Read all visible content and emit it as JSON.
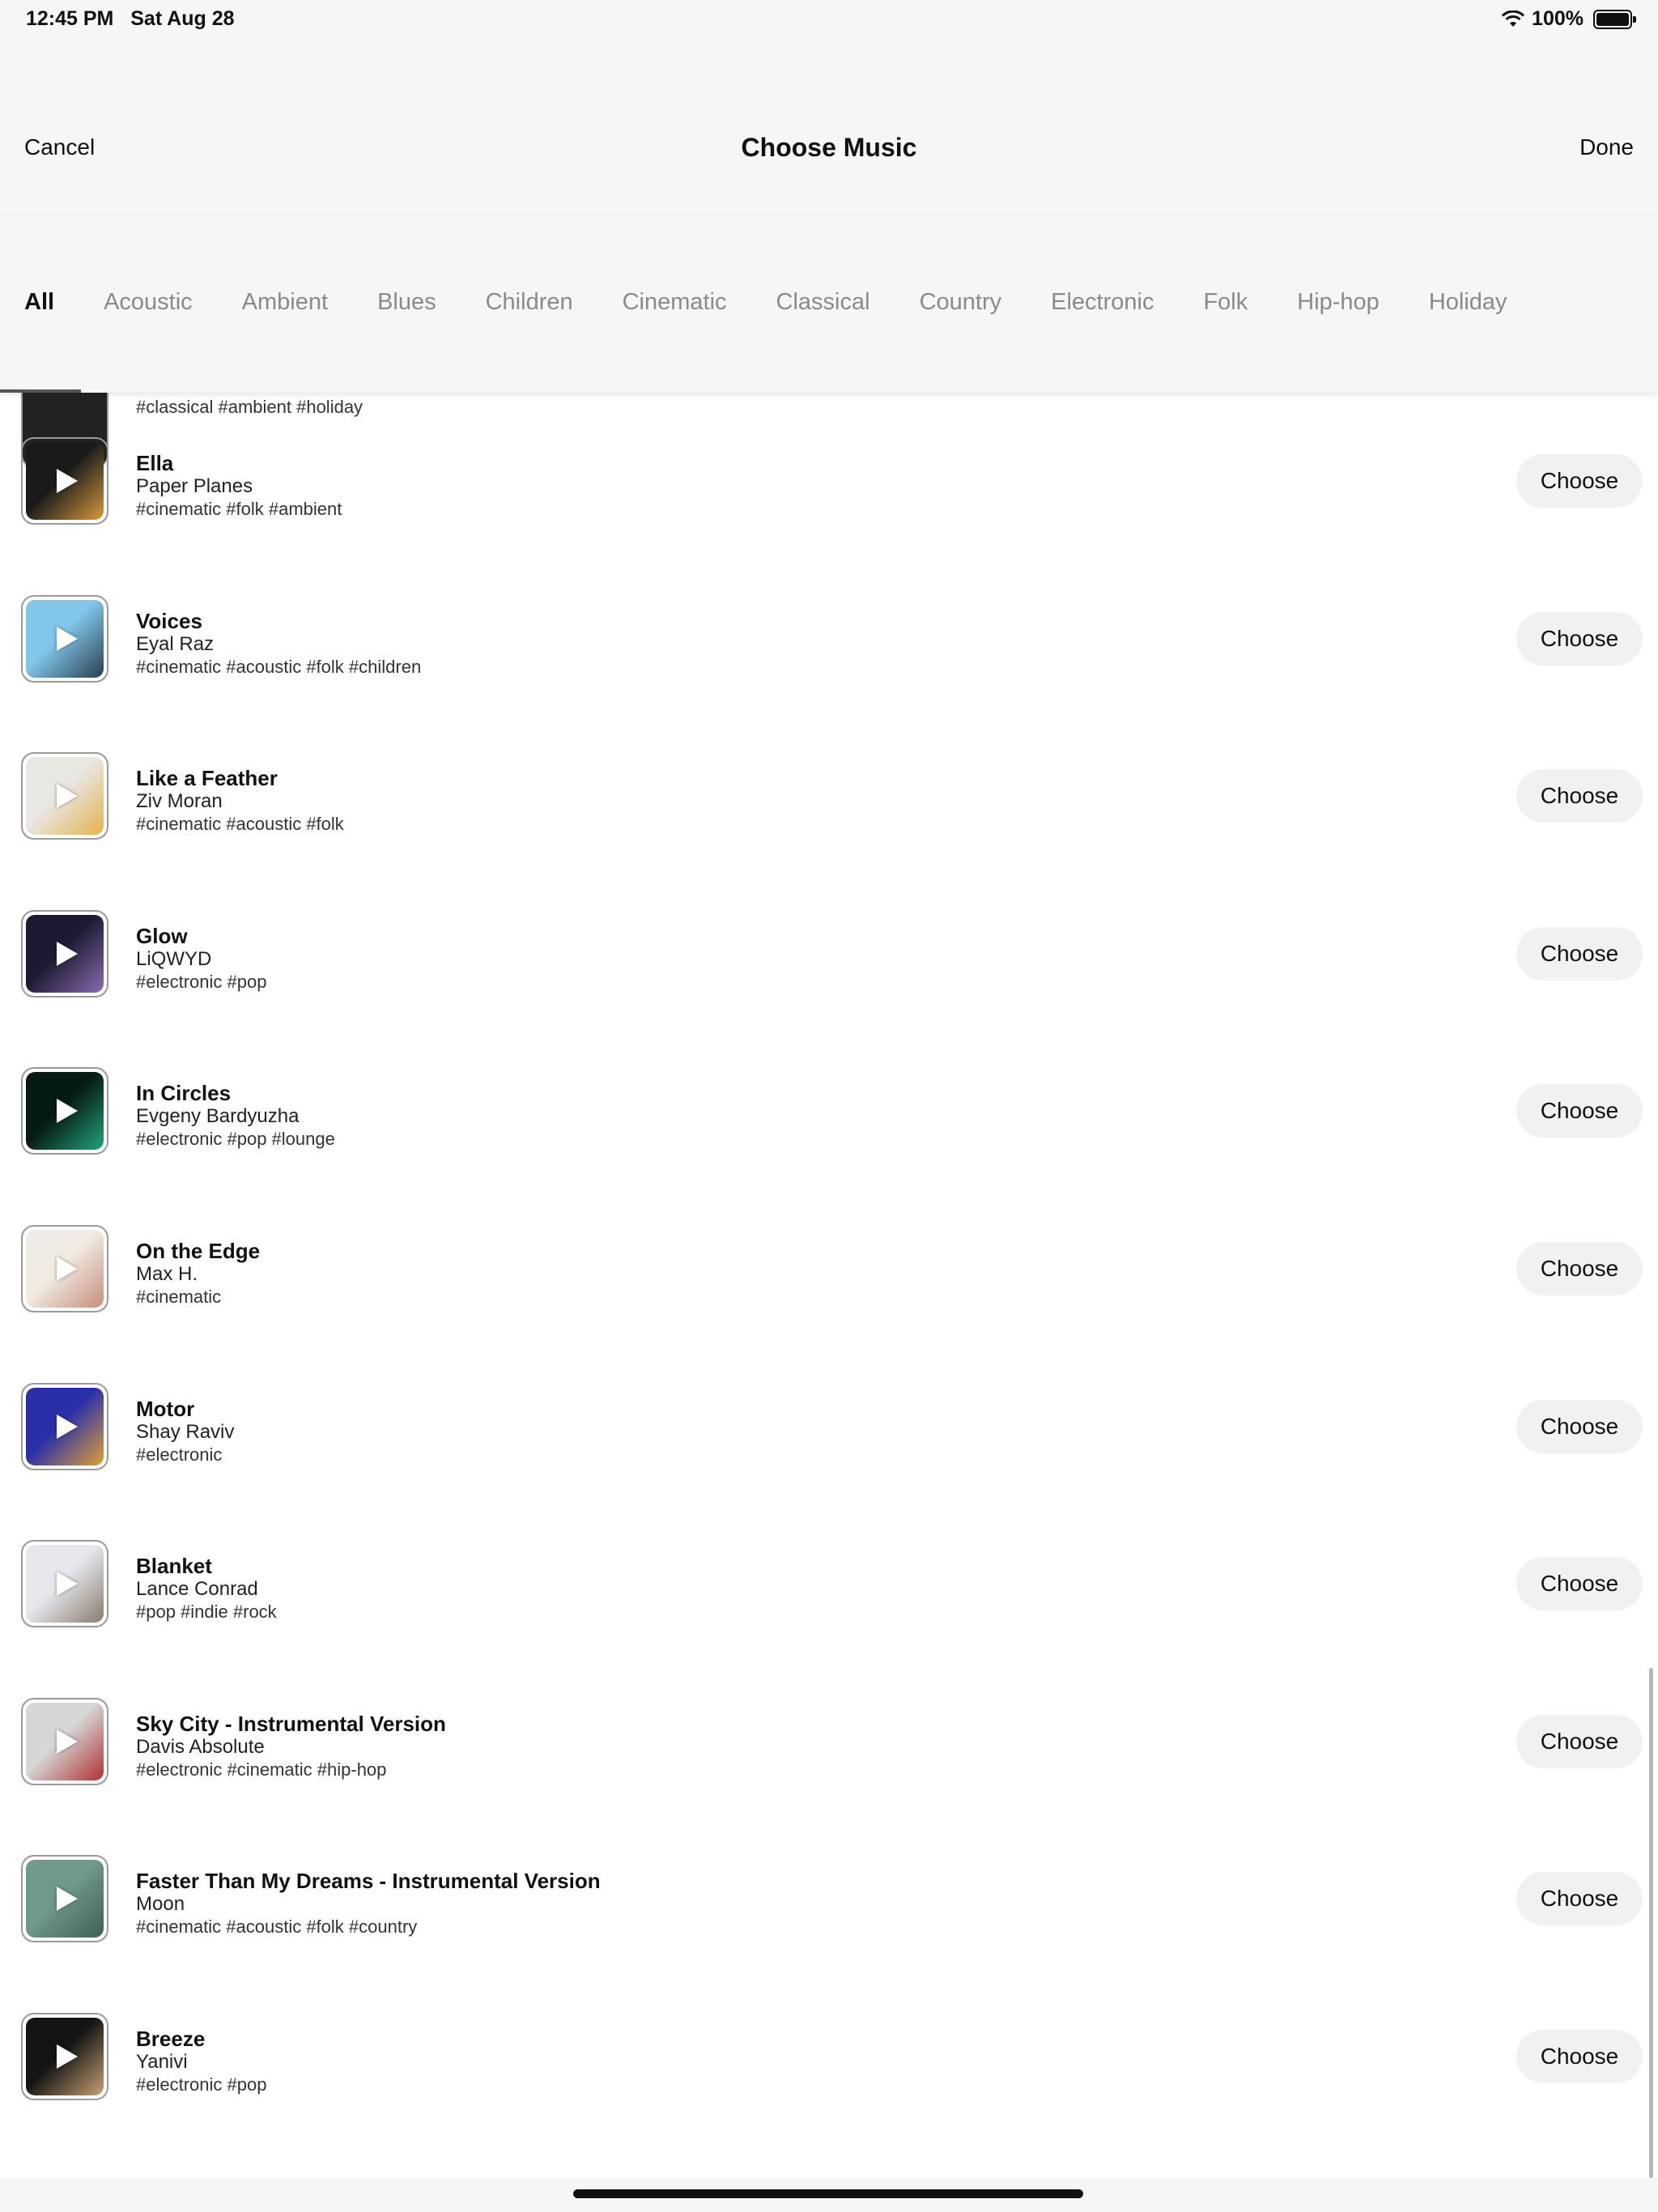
{
  "status_bar": {
    "time": "12:45 PM",
    "date": "Sat Aug 28",
    "battery": "100%"
  },
  "nav": {
    "cancel": "Cancel",
    "title": "Choose Music",
    "done": "Done"
  },
  "tabs": [
    "All",
    "Acoustic",
    "Ambient",
    "Blues",
    "Children",
    "Cinematic",
    "Classical",
    "Country",
    "Electronic",
    "Folk",
    "Hip-hop",
    "Holiday"
  ],
  "active_tab": "All",
  "partial_row_tags": "#classical #ambient #holiday",
  "choose_label": "Choose",
  "tracks": [
    {
      "title": "Ella",
      "artist": "Paper Planes",
      "tags": "#cinematic #folk #ambient",
      "art_colors": [
        "#1a1a1a",
        "#d79a3a"
      ]
    },
    {
      "title": "Voices",
      "artist": "Eyal Raz",
      "tags": "#cinematic #acoustic #folk #children",
      "art_colors": [
        "#7fc6e8",
        "#2a3d4f"
      ]
    },
    {
      "title": "Like a Feather",
      "artist": "Ziv Moran",
      "tags": "#cinematic #acoustic #folk",
      "art_colors": [
        "#e9e7e2",
        "#e4b24a"
      ]
    },
    {
      "title": "Glow",
      "artist": "LiQWYD",
      "tags": "#electronic #pop",
      "art_colors": [
        "#1c1a33",
        "#8a6bb0"
      ]
    },
    {
      "title": "In Circles",
      "artist": "Evgeny Bardyuzha",
      "tags": "#electronic #pop #lounge",
      "art_colors": [
        "#061a14",
        "#1fa37c"
      ]
    },
    {
      "title": "On the Edge",
      "artist": "Max H.",
      "tags": "#cinematic",
      "art_colors": [
        "#f1ece3",
        "#c88d7c"
      ]
    },
    {
      "title": "Motor",
      "artist": "Shay Raviv",
      "tags": "#electronic",
      "art_colors": [
        "#2a2fa8",
        "#e0a032"
      ]
    },
    {
      "title": "Blanket",
      "artist": "Lance Conrad",
      "tags": "#pop #indie #rock",
      "art_colors": [
        "#e6e8ee",
        "#8a7b70"
      ]
    },
    {
      "title": "Sky City - Instrumental Version",
      "artist": "Davis Absolute",
      "tags": "#electronic #cinematic #hip-hop",
      "art_colors": [
        "#d6d6d6",
        "#b03030"
      ]
    },
    {
      "title": "Faster Than My Dreams - Instrumental Version",
      "artist": "Moon",
      "tags": "#cinematic #acoustic #folk #country",
      "art_colors": [
        "#6f9a8a",
        "#3f5f55"
      ]
    },
    {
      "title": "Breeze",
      "artist": "Yanivi",
      "tags": "#electronic #pop",
      "art_colors": [
        "#141414",
        "#c8a070"
      ]
    }
  ]
}
